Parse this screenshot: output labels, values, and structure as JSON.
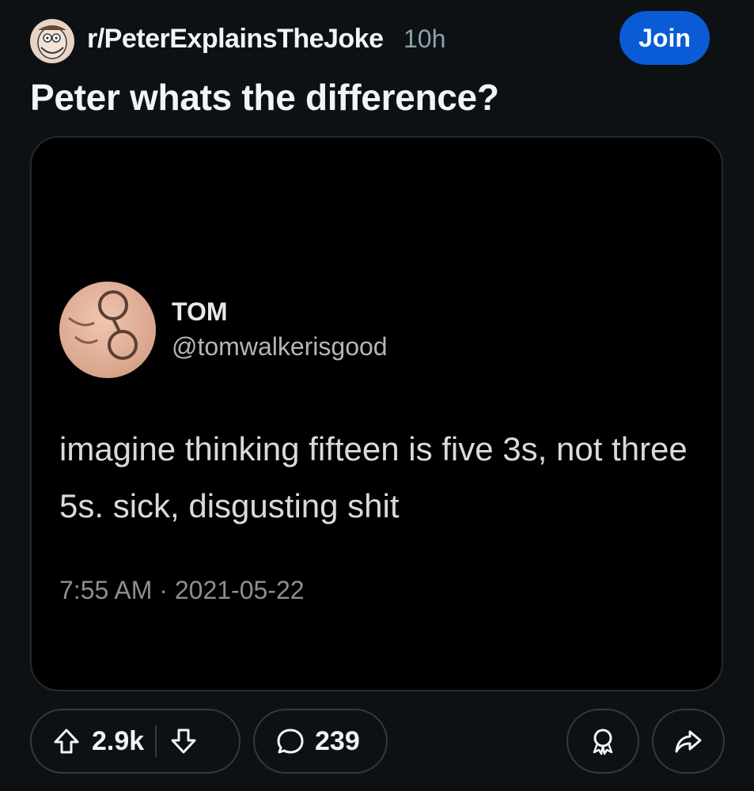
{
  "header": {
    "subreddit": "r/PeterExplainsTheJoke",
    "age": "10h",
    "join_label": "Join"
  },
  "post": {
    "title": "Peter whats the difference?"
  },
  "tweet": {
    "name": "TOM",
    "handle": "@tomwalkerisgood",
    "text": "imagine thinking fifteen is five 3s, not three 5s. sick, disgusting shit",
    "timestamp": "7:55 AM · 2021-05-22"
  },
  "actions": {
    "upvotes": "2.9k",
    "comments": "239",
    "icons": [
      "upvote-icon",
      "downvote-icon",
      "comment-icon",
      "award-icon",
      "share-icon"
    ]
  },
  "colors": {
    "background": "#0e1113",
    "join_button": "#0a5bd6",
    "muted_text": "#8ba2ad"
  }
}
